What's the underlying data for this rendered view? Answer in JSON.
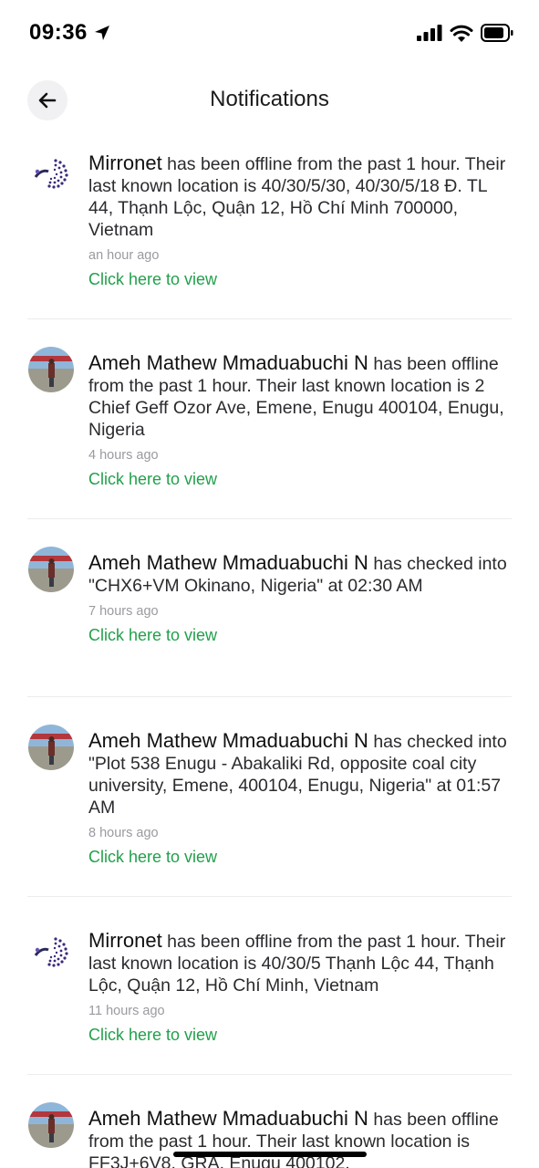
{
  "status_bar": {
    "time": "09:36"
  },
  "header": {
    "title": "Notifications"
  },
  "notifications": [
    {
      "avatar": "mirronet-logo",
      "name": "Mirronet",
      "message": " has been offline from the past 1 hour. Their last known location is 40/30/5/30, 40/30/5/18 Đ. TL 44, Thạnh Lộc, Quận 12, Hồ Chí Minh 700000, Vietnam",
      "time": "an hour ago",
      "cta": "Click here to view"
    },
    {
      "avatar": "user-photo",
      "name": "Ameh Mathew Mmaduabuchi N",
      "message": " has been offline from the past 1 hour. Their last known location is 2 Chief Geff Ozor Ave, Emene, Enugu 400104, Enugu, Nigeria",
      "time": "4 hours ago",
      "cta": "Click here to view"
    },
    {
      "avatar": "user-photo",
      "name": "Ameh Mathew Mmaduabuchi N",
      "message": " has checked into \"CHX6+VM Okinano, Nigeria\" at 02:30 AM",
      "time": "7 hours ago",
      "cta": "Click here to view"
    },
    {
      "avatar": "user-photo",
      "name": "Ameh Mathew Mmaduabuchi N",
      "message": " has checked into \"Plot 538 Enugu - Abakaliki Rd, opposite coal city university, Emene, 400104, Enugu, Nigeria\" at 01:57 AM",
      "time": "8 hours ago",
      "cta": "Click here to view"
    },
    {
      "avatar": "mirronet-logo",
      "name": "Mirronet",
      "message": " has been offline from the past 1 hour. Their last known location is 40/30/5 Thạnh Lộc 44, Thạnh Lộc, Quận 12, Hồ Chí Minh, Vietnam",
      "time": "11 hours ago",
      "cta": "Click here to view"
    },
    {
      "avatar": "user-photo",
      "name": "Ameh Mathew Mmaduabuchi N",
      "message": " has been offline from the past 1 hour. Their last known location is FF3J+6V8, GRA, Enugu 400102,",
      "time": "",
      "cta": ""
    }
  ],
  "colors": {
    "accent_green": "#22a04b",
    "divider": "#ececef",
    "muted": "#9a9aa0"
  }
}
